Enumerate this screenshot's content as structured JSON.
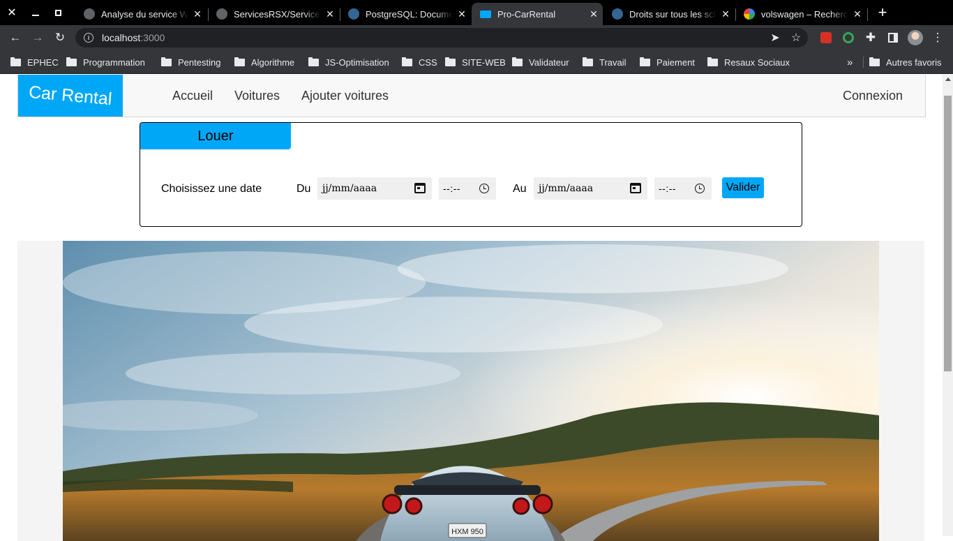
{
  "browser": {
    "tabs": [
      {
        "title": "Analyse du service W",
        "active": false
      },
      {
        "title": "ServicesRSX/Services",
        "active": false
      },
      {
        "title": "PostgreSQL: Docume",
        "active": false
      },
      {
        "title": "Pro-CarRental",
        "active": true
      },
      {
        "title": "Droits sur tous les sch",
        "active": false
      },
      {
        "title": "volswagen – Recherc",
        "active": false
      }
    ],
    "url_host": "localhost",
    "url_port": ":3000",
    "bookmarks": [
      "EPHEC",
      "Programmation",
      "Pentesting",
      "Algorithme",
      "JS-Optimisation",
      "CSS",
      "SITE-WEB",
      "Validateur",
      "Travail",
      "Paiement",
      "Resaux Sociaux"
    ],
    "bookmarks_overflow": "»",
    "other_bookmarks": "Autres favoris"
  },
  "navbar": {
    "brand": "Car Rental",
    "links": [
      "Accueil",
      "Voitures",
      "Ajouter voitures"
    ],
    "login": "Connexion"
  },
  "rent_form": {
    "tab_label": "Louer",
    "prompt": "Choisissez une date",
    "from_label": "Du",
    "to_label": "Au",
    "date_placeholder": "jj/mm/aaaa",
    "time_placeholder": "--:--",
    "submit": "Valider"
  },
  "hero": {
    "plate": "HXM 950"
  },
  "colors": {
    "accent": "#00a7f7",
    "navbar_bg": "#f8f8f8",
    "chrome_dark": "#35363a"
  }
}
